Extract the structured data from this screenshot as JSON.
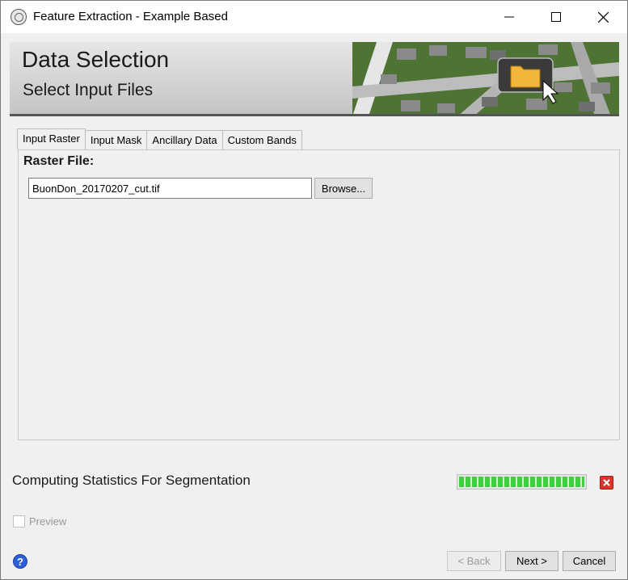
{
  "window": {
    "title": "Feature Extraction - Example Based"
  },
  "banner": {
    "title": "Data Selection",
    "subtitle": "Select Input Files"
  },
  "tabs": [
    {
      "label": "Input Raster",
      "active": true
    },
    {
      "label": "Input Mask",
      "active": false
    },
    {
      "label": "Ancillary Data",
      "active": false
    },
    {
      "label": "Custom Bands",
      "active": false
    }
  ],
  "raster": {
    "label": "Raster File:",
    "value": "BuonDon_20170207_cut.tif",
    "browse_label": "Browse..."
  },
  "status": {
    "text": "Computing Statistics For Segmentation",
    "progress_fraction": 1.0
  },
  "preview": {
    "label": "Preview",
    "checked": false
  },
  "footer": {
    "back_label": "< Back",
    "next_label": "Next >",
    "cancel_label": "Cancel"
  },
  "colors": {
    "progress": "#3fcf3f",
    "cancel_red": "#d9352b",
    "help_blue": "#2d5fd8"
  }
}
